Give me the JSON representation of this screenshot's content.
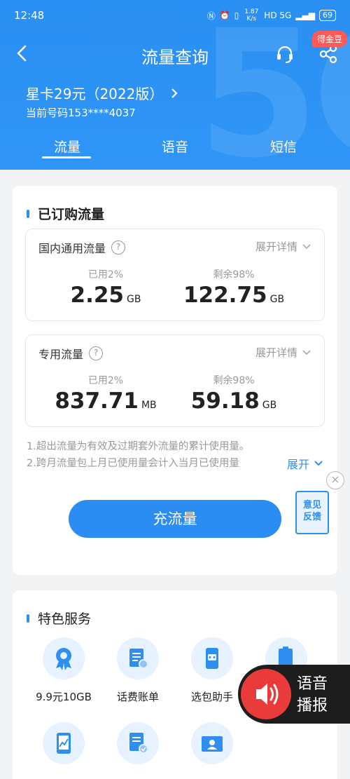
{
  "status_bar": {
    "time": "12:48",
    "speed": "1.87 K/s",
    "network": "HD 5G",
    "battery": "69"
  },
  "header": {
    "title": "流量查询",
    "badge": "得金豆",
    "plan_name": "星卡29元（2022版）",
    "phone_number": "当前号码153****4037",
    "tabs": [
      {
        "label": "流量",
        "active": true
      },
      {
        "label": "语音",
        "active": false
      },
      {
        "label": "短信",
        "active": false
      }
    ]
  },
  "subscribed": {
    "title": "已订购流量",
    "domestic": {
      "label": "国内通用流量",
      "expand": "展开详情",
      "used_label": "已用2%",
      "used_value": "2.25",
      "used_unit": "GB",
      "remain_label": "剩余98%",
      "remain_value": "122.75",
      "remain_unit": "GB"
    },
    "dedicated": {
      "label": "专用流量",
      "expand": "展开详情",
      "used_label": "已用2%",
      "used_value": "837.71",
      "used_unit": "MB",
      "remain_label": "剩余98%",
      "remain_value": "59.18",
      "remain_unit": "GB"
    },
    "note1": "1.超出流量为有效及过期套外流量的累计使用量。",
    "note2": "2.跨月流量包上月已使用量会计入当月已使用量",
    "notes_expand": "展开",
    "recharge": "充流量"
  },
  "feedback": {
    "line1": "意见",
    "line2": "反馈"
  },
  "services": {
    "title": "特色服务",
    "items": [
      {
        "label": "9.9元10GB",
        "icon": "medal-icon"
      },
      {
        "label": "话费账单",
        "icon": "bill-icon"
      },
      {
        "label": "选包助手",
        "icon": "robot-icon"
      },
      {
        "label": "",
        "icon": "clipboard-icon"
      },
      {
        "label": "",
        "icon": "phone-chart-icon"
      },
      {
        "label": "",
        "icon": "doc-check-icon"
      },
      {
        "label": "",
        "icon": "id-card-icon"
      }
    ]
  },
  "voice_broadcast": {
    "line1": "语音",
    "line2": "播报"
  },
  "colors": {
    "primary": "#2b8df2",
    "badge": "#ff5a55",
    "voice_bg": "#1d1d1d",
    "voice_icon": "#ea3b3b"
  }
}
